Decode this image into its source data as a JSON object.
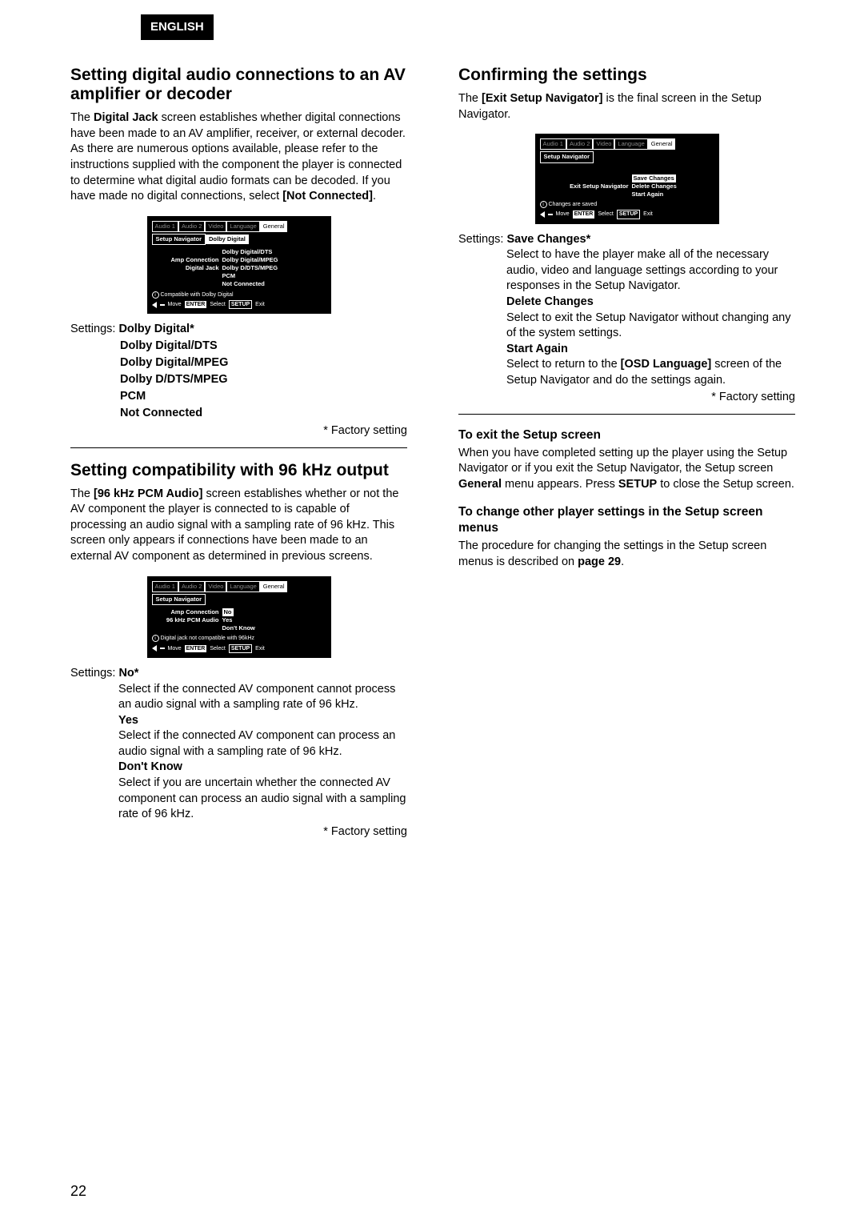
{
  "lang_tab": "ENGLISH",
  "page_number": "22",
  "left": {
    "sec1": {
      "title": "Setting digital audio connections to an AV amplifier or decoder",
      "para_parts": {
        "p1": "The ",
        "b1": "Digital Jack",
        "p2": " screen establishes whether digital connections have been made to an AV amplifier, receiver, or external decoder. As there are numerous options available, please refer to the instructions supplied with the component the player is connected to determine what digital audio formats can be decoded. If you have made no digital connections, select ",
        "b2": "[Not Connected]",
        "p3": "."
      },
      "osd": {
        "tabs": [
          "Audio 1",
          "Audio 2",
          "Video",
          "Language",
          "General"
        ],
        "bar": "Setup Navigator",
        "val": "Dolby Digital",
        "rows_left": [
          "",
          "Amp Connection",
          "Digital Jack",
          "",
          ""
        ],
        "rows_right": [
          "Dolby Digital/DTS",
          "Dolby Digital/MPEG",
          "Dolby D/DTS/MPEG",
          "PCM",
          "Not Connected"
        ],
        "hint": "Compatible with Dolby Digital",
        "foot_move": "Move",
        "foot_enter": "ENTER",
        "foot_select": "Select",
        "foot_setup": "SETUP",
        "foot_exit": "Exit"
      },
      "settings_label": "Settings:",
      "opt1": "Dolby Digital*",
      "opts": [
        "Dolby Digital/DTS",
        "Dolby Digital/MPEG",
        "Dolby D/DTS/MPEG",
        "PCM",
        "Not Connected"
      ],
      "factory": "* Factory setting"
    },
    "sec2": {
      "title": "Setting compatibility with 96 kHz output",
      "para_parts": {
        "p1": "The ",
        "b1": "[96 kHz PCM Audio]",
        "p2": " screen establishes whether or not the AV component the player is connected to is capable of processing an audio signal with a sampling rate of 96 kHz. This screen only appears if connections have been made to an external AV component as determined in previous screens."
      },
      "osd": {
        "tabs": [
          "Audio 1",
          "Audio 2",
          "Video",
          "Language",
          "General"
        ],
        "bar": "Setup Navigator",
        "rows_left": [
          "Amp Connection",
          "96 kHz PCM Audio",
          ""
        ],
        "rows_right_sel": "No",
        "rows_right": [
          "Yes",
          "Don't Know"
        ],
        "hint": "Digital jack not compatible with 96kHz",
        "foot_move": "Move",
        "foot_enter": "ENTER",
        "foot_select": "Select",
        "foot_setup": "SETUP",
        "foot_exit": "Exit"
      },
      "settings_label": "Settings:",
      "d1t": "No*",
      "d1": "Select if the connected AV component cannot process an audio signal with a sampling rate of 96 kHz.",
      "d2t": "Yes",
      "d2": "Select if the connected AV component can process an audio signal with a sampling rate of 96 kHz.",
      "d3t": "Don't Know",
      "d3": "Select if you are uncertain whether the connected AV component can process an audio signal with a sampling rate of 96 kHz.",
      "factory": "* Factory setting"
    }
  },
  "right": {
    "sec1": {
      "title": "Confirming the settings",
      "para_parts": {
        "p1": "The ",
        "b1": "[Exit Setup Navigator]",
        "p2": " is the final screen in the Setup Navigator."
      },
      "osd": {
        "tabs": [
          "Audio 1",
          "Audio 2",
          "Video",
          "Language",
          "General"
        ],
        "bar": "Setup Navigator",
        "row_left": "Exit Setup Navigator",
        "row_sel": "Save Changes",
        "rows_right": [
          "Delete Changes",
          "Start Again"
        ],
        "hint": "Changes are saved",
        "foot_move": "Move",
        "foot_enter": "ENTER",
        "foot_select": "Select",
        "foot_setup": "SETUP",
        "foot_exit": "Exit"
      },
      "settings_label": "Settings:",
      "d1t": "Save Changes*",
      "d1": "Select to have the player make all of the necessary audio, video and language settings according to your responses in the Setup Navigator.",
      "d2t": "Delete Changes",
      "d2": "Select to exit the Setup Navigator without changing any of the system settings.",
      "d3t": "Start Again",
      "d3a": "Select to return to the ",
      "d3b": "[OSD Language]",
      "d3c": " screen of the Setup Navigator and do the settings again.",
      "factory": "* Factory setting"
    },
    "sec2": {
      "h1": "To exit the Setup screen",
      "p1a": "When you have completed setting up the player using the Setup Navigator or if you exit the Setup Navigator, the Setup screen ",
      "p1b": "General",
      "p1c": " menu appears. Press ",
      "p1d": "SETUP",
      "p1e": " to close the Setup screen.",
      "h2": "To change other player settings in the Setup screen menus",
      "p2a": "The procedure for changing the settings in the Setup screen menus is described on ",
      "p2b": "page 29",
      "p2c": "."
    }
  }
}
